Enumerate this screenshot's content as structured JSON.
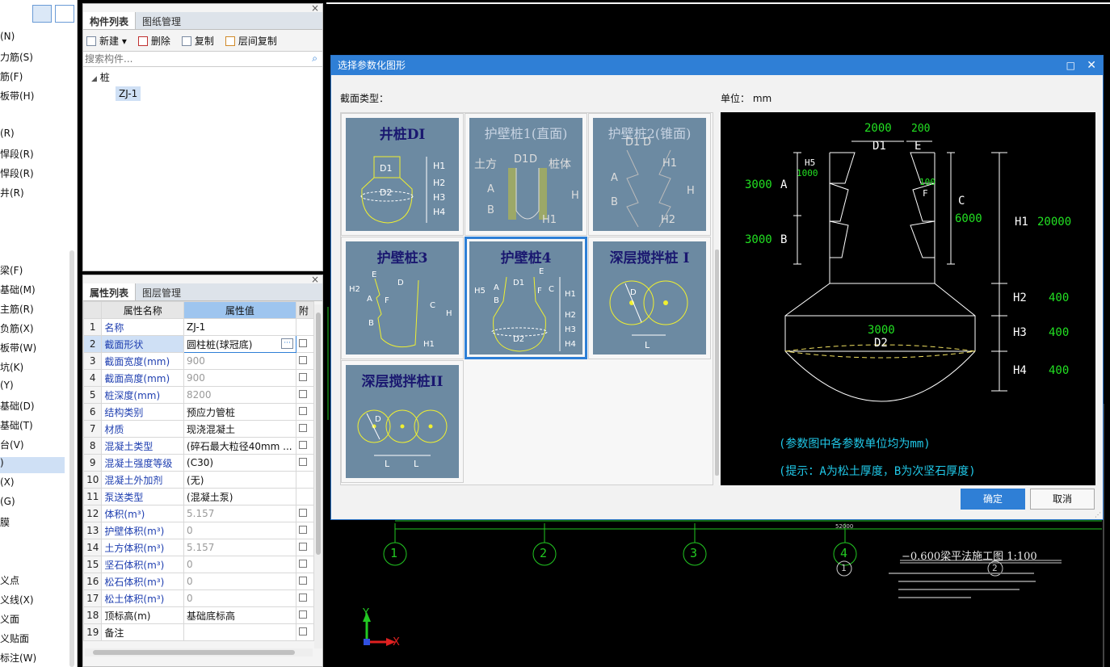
{
  "left_strip": {
    "items": [
      "(N)",
      "力筋(S)",
      "筋(F)",
      "板带(H)",
      "(R)",
      "悍段(R)",
      "悍段(R)",
      "井(R)",
      "梁(F)",
      "基础(M)",
      "主筋(R)",
      "负筋(X)",
      "板带(W)",
      "坑(K)",
      "(Y)",
      "基础(D)",
      "基础(T)",
      "台(V)",
      ")",
      "(X)",
      "(G)",
      "膜",
      "义点",
      "义线(X)",
      "义面",
      "义贴面",
      "标注(W)"
    ]
  },
  "component_panel": {
    "tabs": [
      "构件列表",
      "图纸管理"
    ],
    "toolbar": [
      "新建",
      "删除",
      "复制",
      "层间复制"
    ],
    "search_placeholder": "搜索构件...",
    "tree_root": "桩",
    "tree_child": "ZJ-1"
  },
  "property_panel": {
    "tabs": [
      "属性列表",
      "图层管理"
    ],
    "header_name": "属性名称",
    "header_value": "属性值",
    "header_extra": "附",
    "rows": [
      {
        "n": "1",
        "k": "名称",
        "v": "ZJ-1",
        "blue": true,
        "gray": false,
        "cb": false
      },
      {
        "n": "2",
        "k": "截面形状",
        "v": "圆柱桩(球冠底)",
        "blue": true,
        "gray": false,
        "cb": true
      },
      {
        "n": "3",
        "k": "截面宽度(mm)",
        "v": "900",
        "blue": true,
        "gray": true,
        "cb": true
      },
      {
        "n": "4",
        "k": "截面高度(mm)",
        "v": "900",
        "blue": true,
        "gray": true,
        "cb": true
      },
      {
        "n": "5",
        "k": "桩深度(mm)",
        "v": "8200",
        "blue": true,
        "gray": true,
        "cb": true
      },
      {
        "n": "6",
        "k": "结构类别",
        "v": "预应力管桩",
        "blue": true,
        "gray": false,
        "cb": true
      },
      {
        "n": "7",
        "k": "材质",
        "v": "现浇混凝土",
        "blue": true,
        "gray": false,
        "cb": true
      },
      {
        "n": "8",
        "k": "混凝土类型",
        "v": "(碎石最大粒径40mm ...",
        "blue": true,
        "gray": false,
        "cb": true
      },
      {
        "n": "9",
        "k": "混凝土强度等级",
        "v": "(C30)",
        "blue": true,
        "gray": false,
        "cb": true
      },
      {
        "n": "10",
        "k": "混凝土外加剂",
        "v": "(无)",
        "blue": true,
        "gray": false,
        "cb": false
      },
      {
        "n": "11",
        "k": "泵送类型",
        "v": "(混凝土泵)",
        "blue": true,
        "gray": false,
        "cb": false
      },
      {
        "n": "12",
        "k": "体积(m³)",
        "v": "5.157",
        "blue": true,
        "gray": true,
        "cb": true
      },
      {
        "n": "13",
        "k": "护壁体积(m³)",
        "v": "0",
        "blue": true,
        "gray": true,
        "cb": true
      },
      {
        "n": "14",
        "k": "土方体积(m³)",
        "v": "5.157",
        "blue": true,
        "gray": true,
        "cb": true
      },
      {
        "n": "15",
        "k": "坚石体积(m³)",
        "v": "0",
        "blue": true,
        "gray": true,
        "cb": true
      },
      {
        "n": "16",
        "k": "松石体积(m³)",
        "v": "0",
        "blue": true,
        "gray": true,
        "cb": true
      },
      {
        "n": "17",
        "k": "松土体积(m³)",
        "v": "0",
        "blue": true,
        "gray": true,
        "cb": true
      },
      {
        "n": "18",
        "k": "顶标高(m)",
        "v": "基础底标高",
        "blue": false,
        "gray": false,
        "cb": true
      },
      {
        "n": "19",
        "k": "备注",
        "v": "",
        "blue": false,
        "gray": false,
        "cb": true
      }
    ]
  },
  "dialog": {
    "title": "选择参数化图形",
    "section_label": "截面类型：",
    "unit_label": "单位：",
    "unit_value": "mm",
    "shapes": [
      "井桩DI",
      "护壁桩1(直面)",
      "护壁桩2(锥面)",
      "护壁桩3",
      "护壁桩4",
      "深层搅拌桩 I",
      "深层搅拌桩II"
    ],
    "selected_shape": "护壁桩4",
    "confirm": "确定",
    "cancel": "取消",
    "preview": {
      "values": {
        "D1": "2000",
        "E": "200",
        "A": "3000",
        "B": "3000",
        "H5": "1000",
        "C": "6000",
        "F": "100",
        "H1": "20000",
        "H2": "400",
        "H3": "400",
        "H4": "400",
        "D2": "3000"
      },
      "note1": "(参数图中各参数单位均为mm)",
      "note2": "(提示：A为松土厚度，B为次坚石厚度)"
    }
  },
  "cad": {
    "axis_labels": [
      "1",
      "2",
      "3",
      "4",
      "1",
      "2"
    ],
    "drawing_title": "−0.600梁平法施工图 1:100",
    "dim_text": "52000",
    "axis_y": "Y",
    "axis_x": "X"
  },
  "colors": {
    "dialog_title": "#2f7fd6",
    "cad_green": "#18c818",
    "shape_bg": "#6c8aa2"
  }
}
